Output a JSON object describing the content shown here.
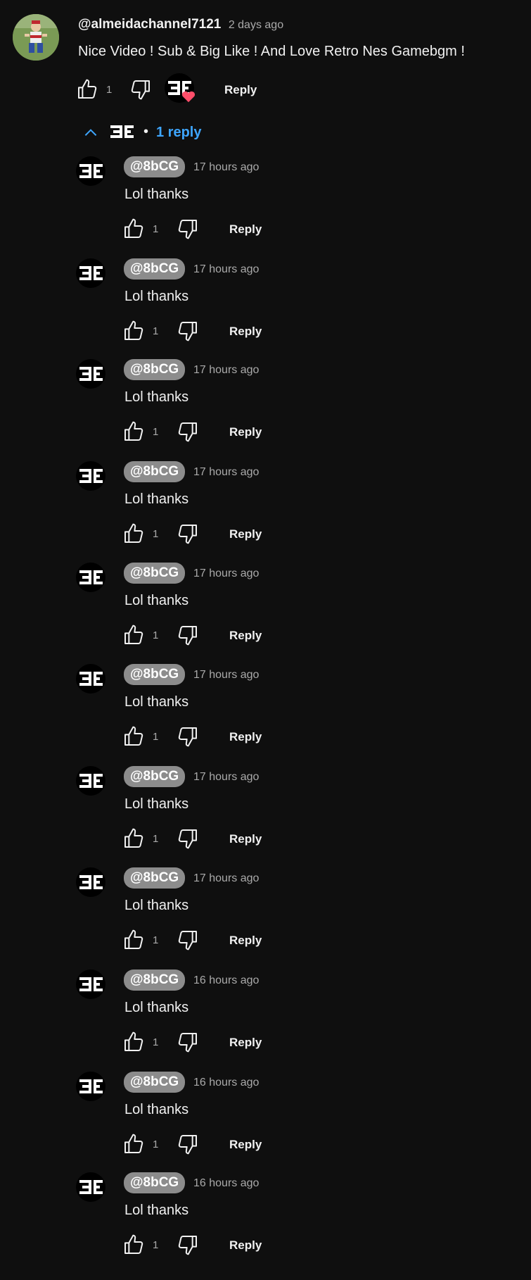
{
  "comment": {
    "author": "@almeidachannel7121",
    "timestamp": "2 days ago",
    "text": "Nice Video ! Sub & Big Like ! And Love Retro Nes Gamebgm !",
    "like_count": "1",
    "reply_label": "Reply",
    "heart_color": "#ff4e6a"
  },
  "replies_toggle": {
    "separator": "•",
    "label": "1 reply",
    "color": "#3ea6ff"
  },
  "replies": [
    {
      "handle": "@8bCG",
      "timestamp": "17 hours ago",
      "text": "Lol thanks",
      "like_count": "1",
      "reply_label": "Reply"
    },
    {
      "handle": "@8bCG",
      "timestamp": "17 hours ago",
      "text": "Lol thanks",
      "like_count": "1",
      "reply_label": "Reply"
    },
    {
      "handle": "@8bCG",
      "timestamp": "17 hours ago",
      "text": "Lol thanks",
      "like_count": "1",
      "reply_label": "Reply"
    },
    {
      "handle": "@8bCG",
      "timestamp": "17 hours ago",
      "text": "Lol thanks",
      "like_count": "1",
      "reply_label": "Reply"
    },
    {
      "handle": "@8bCG",
      "timestamp": "17 hours ago",
      "text": "Lol thanks",
      "like_count": "1",
      "reply_label": "Reply"
    },
    {
      "handle": "@8bCG",
      "timestamp": "17 hours ago",
      "text": "Lol thanks",
      "like_count": "1",
      "reply_label": "Reply"
    },
    {
      "handle": "@8bCG",
      "timestamp": "17 hours ago",
      "text": "Lol thanks",
      "like_count": "1",
      "reply_label": "Reply"
    },
    {
      "handle": "@8bCG",
      "timestamp": "17 hours ago",
      "text": "Lol thanks",
      "like_count": "1",
      "reply_label": "Reply"
    },
    {
      "handle": "@8bCG",
      "timestamp": "16 hours ago",
      "text": "Lol thanks",
      "like_count": "1",
      "reply_label": "Reply"
    },
    {
      "handle": "@8bCG",
      "timestamp": "16 hours ago",
      "text": "Lol thanks",
      "like_count": "1",
      "reply_label": "Reply"
    },
    {
      "handle": "@8bCG",
      "timestamp": "16 hours ago",
      "text": "Lol thanks",
      "like_count": "1",
      "reply_label": "Reply"
    }
  ]
}
